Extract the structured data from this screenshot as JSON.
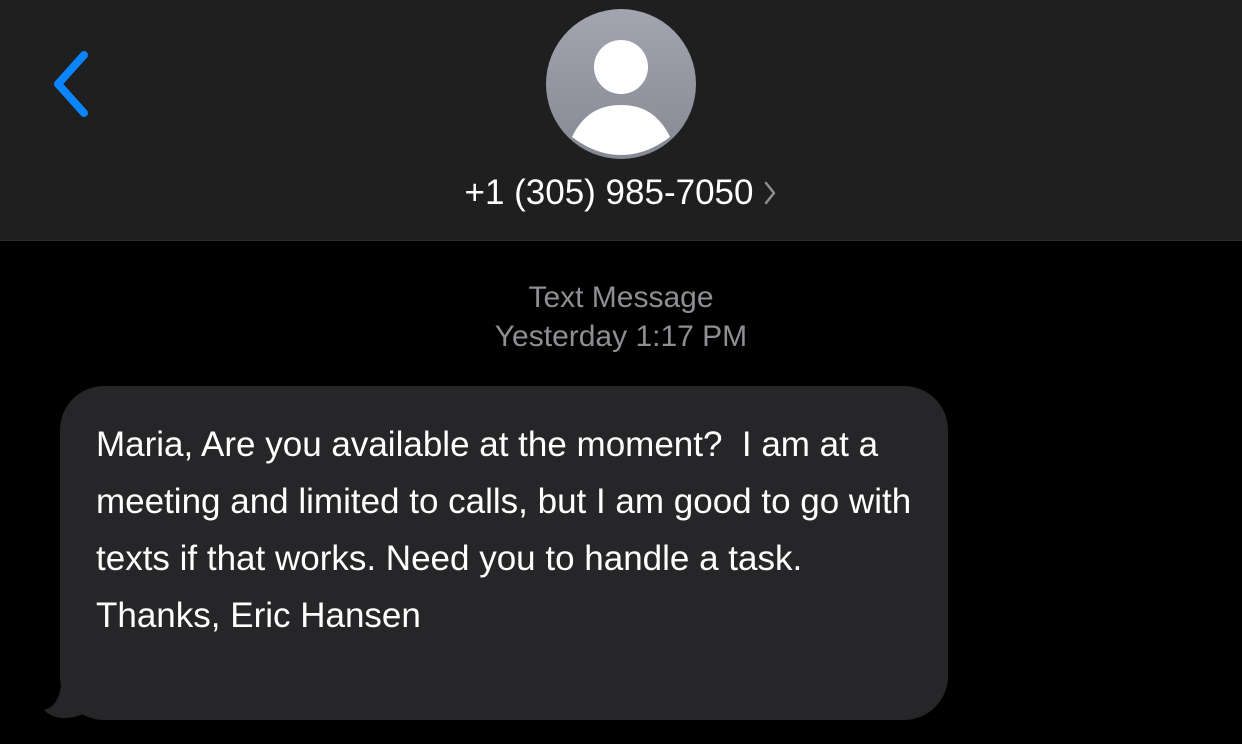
{
  "header": {
    "back_icon": "chevron-left-icon",
    "avatar_icon": "person-icon",
    "contact_name": "+1 (305) 985-7050",
    "contact_chevron_icon": "chevron-right-icon",
    "accent_color": "#0a84ff"
  },
  "thread": {
    "service_label": "Text Message",
    "timestamp": "Yesterday 1:17 PM",
    "messages": [
      {
        "direction": "incoming",
        "text": "Maria, Are you available at the moment?  I am at a meeting and limited to calls, but I am good to go with texts if that works. Need you to handle a task. Thanks, Eric Hansen"
      }
    ]
  }
}
